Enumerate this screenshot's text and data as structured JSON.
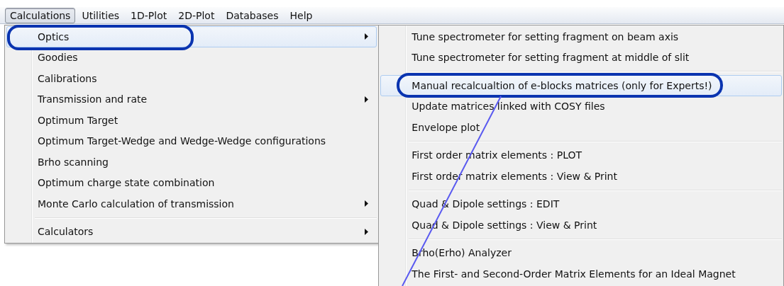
{
  "menubar": [
    {
      "label": "Calculations",
      "selected": true
    },
    {
      "label": "Utilities",
      "selected": false
    },
    {
      "label": "1D-Plot",
      "selected": false
    },
    {
      "label": "2D-Plot",
      "selected": false
    },
    {
      "label": "Databases",
      "selected": false
    },
    {
      "label": "Help",
      "selected": false
    }
  ],
  "menu": {
    "items": [
      {
        "kind": "item",
        "label": "Optics",
        "selected": true,
        "submenu": true
      },
      {
        "kind": "item",
        "label": "Goodies",
        "selected": false,
        "submenu": false
      },
      {
        "kind": "item",
        "label": "Calibrations",
        "selected": false,
        "submenu": false
      },
      {
        "kind": "item",
        "label": "Transmission and rate",
        "selected": false,
        "submenu": true
      },
      {
        "kind": "item",
        "label": "Optimum Target",
        "selected": false,
        "submenu": false
      },
      {
        "kind": "item",
        "label": "Optimum Target-Wedge and Wedge-Wedge configurations",
        "selected": false,
        "submenu": false
      },
      {
        "kind": "item",
        "label": "Brho scanning",
        "selected": false,
        "submenu": false
      },
      {
        "kind": "item",
        "label": "Optimum charge state combination",
        "selected": false,
        "submenu": false
      },
      {
        "kind": "item",
        "label": "Monte Carlo calculation of transmission",
        "selected": false,
        "submenu": true
      },
      {
        "kind": "separator"
      },
      {
        "kind": "item",
        "label": "Calculators",
        "selected": false,
        "submenu": true
      }
    ]
  },
  "submenu": {
    "items": [
      {
        "kind": "item",
        "label": "Tune spectrometer for setting fragment on beam axis",
        "selected": false,
        "submenu": false
      },
      {
        "kind": "item",
        "label": "Tune spectrometer for setting fragment at middle of slit",
        "selected": false,
        "submenu": false
      },
      {
        "kind": "separator"
      },
      {
        "kind": "item",
        "label": "Manual recalcualtion of e-blocks matrices (only for Experts!)",
        "selected": true,
        "submenu": false
      },
      {
        "kind": "item",
        "label": "Update matrices linked with COSY files",
        "selected": false,
        "submenu": false
      },
      {
        "kind": "item",
        "label": "Envelope plot",
        "selected": false,
        "submenu": false
      },
      {
        "kind": "separator"
      },
      {
        "kind": "item",
        "label": "First order matrix elements : PLOT",
        "selected": false,
        "submenu": false
      },
      {
        "kind": "item",
        "label": "First order matrix elements : View & Print",
        "selected": false,
        "submenu": false
      },
      {
        "kind": "separator"
      },
      {
        "kind": "item",
        "label": "Quad & Dipole settings : EDIT",
        "selected": false,
        "submenu": false
      },
      {
        "kind": "item",
        "label": "Quad & Dipole settings : View & Print",
        "selected": false,
        "submenu": false
      },
      {
        "kind": "separator"
      },
      {
        "kind": "item",
        "label": "Brho(Erho) Analyzer",
        "selected": false,
        "submenu": false
      },
      {
        "kind": "item",
        "label": "The First- and Second-Order Matrix Elements for an Ideal Magnet",
        "selected": false,
        "submenu": false
      }
    ]
  }
}
